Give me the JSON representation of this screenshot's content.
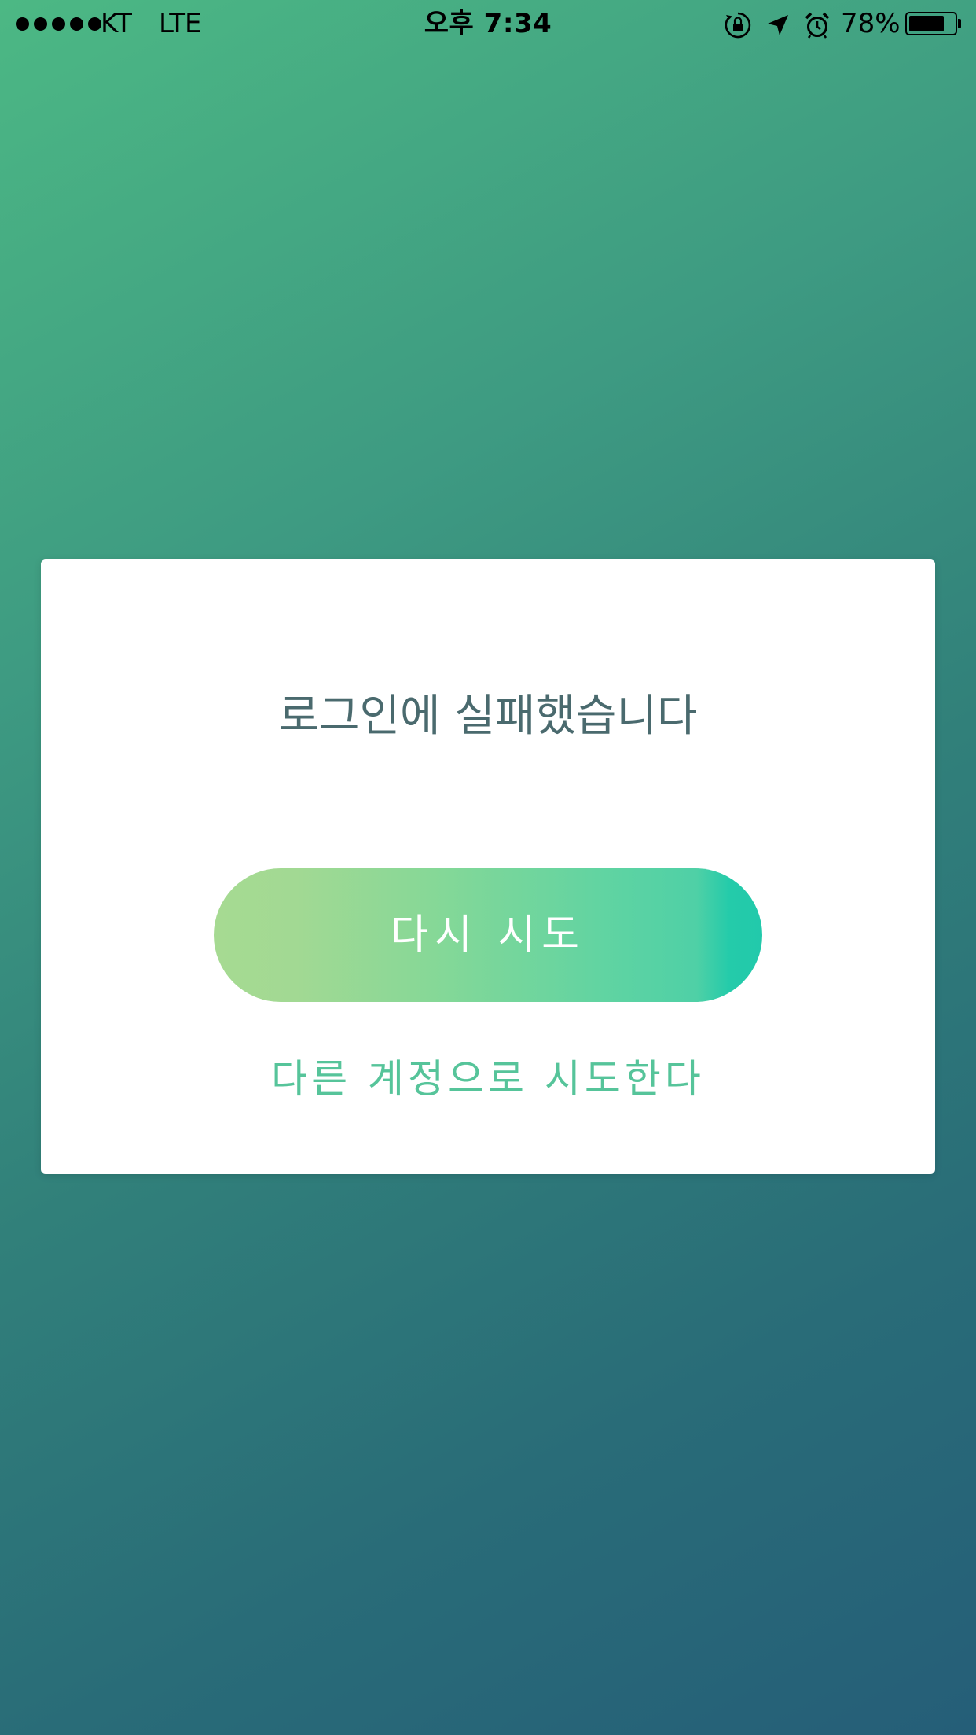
{
  "status_bar": {
    "carrier": "KT",
    "network": "LTE",
    "time": "오후 7:34",
    "battery_percent": "78%",
    "battery_level": 0.78,
    "icons": [
      "orientation-lock-icon",
      "location-arrow-icon",
      "alarm-icon",
      "battery-icon"
    ]
  },
  "dialog": {
    "title": "로그인에 실패했습니다",
    "retry_label": "다시 시도",
    "alt_account_label": "다른 계정으로 시도한다"
  },
  "colors": {
    "background_top": "#4cb884",
    "background_bottom": "#255e78",
    "title_text": "#4a6a6e",
    "button_gradient_start": "#a6da92",
    "button_gradient_end": "#22c9ab",
    "link_text": "#56c49a"
  }
}
